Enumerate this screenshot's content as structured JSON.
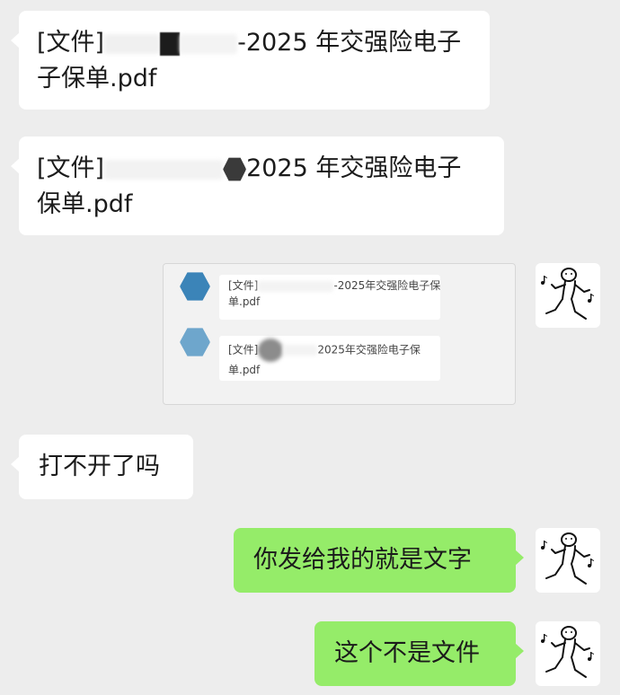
{
  "messages": {
    "m1": {
      "line1_prefix": "[文件]",
      "line1_suffix": "-2025 年交强险电子",
      "line2": "子保单.pdf"
    },
    "m2": {
      "line1_prefix": "[文件]",
      "line1_suffix": "2025 年交强险电子",
      "line2": "保单.pdf"
    },
    "forward_card": {
      "items": [
        {
          "line1_prefix": "[文件]",
          "line1_suffix": "-2025年交强险电子保",
          "line2": "单.pdf"
        },
        {
          "line1_prefix": "[文件]",
          "line1_suffix": "2025年交强险电子保",
          "line2": "单.pdf"
        }
      ]
    },
    "m3": {
      "text": "打不开了吗"
    },
    "m4": {
      "text": "你发给我的就是文字"
    },
    "m5": {
      "text": "这个不是文件"
    }
  },
  "colors": {
    "background": "#ededed",
    "incoming_bubble": "#ffffff",
    "outgoing_bubble": "#95ec69",
    "mini_avatar_1": "#3b84b8",
    "mini_avatar_2": "#6ea6cc"
  },
  "icons": {
    "self_avatar": "dancing-stick-figure-with-music-notes"
  }
}
